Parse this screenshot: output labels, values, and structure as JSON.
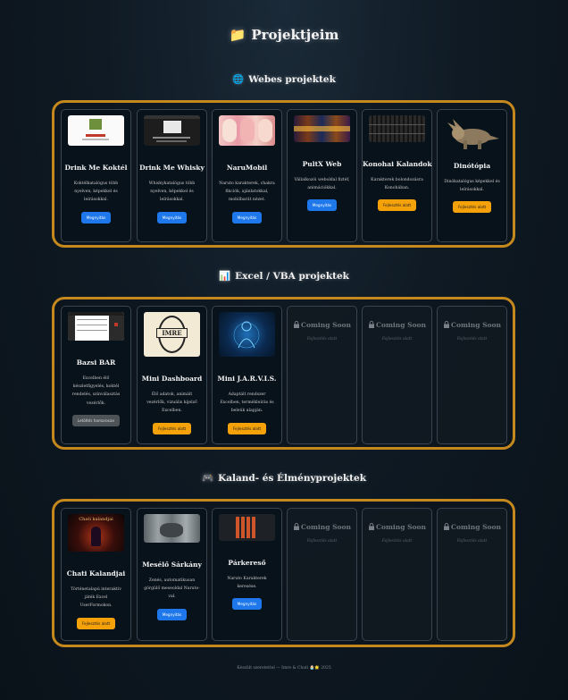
{
  "page_title": "Projektjeim",
  "sections": [
    {
      "title": "Webes projektek",
      "icon": "globe-icon",
      "cards": [
        {
          "name": "Drink Me Koktél",
          "desc": "Koktélkatalógus több nyelven, képekkel és leírásokkal.",
          "button": "Megnyitás",
          "button_color": "blue"
        },
        {
          "name": "Drink Me Whisky",
          "desc": "Whiskykatalógus több nyelven, képekkel és leírásokkal.",
          "button": "Megnyitás",
          "button_color": "blue"
        },
        {
          "name": "NaruMobil",
          "desc": "Naruto karakterek, chakra fikciók, ajánlatokkal, mobilbarát nézet.",
          "button": "Megnyitás",
          "button_color": "blue"
        },
        {
          "name": "PultX Web",
          "desc": "Vállalkozói weboldal fiztéf, animációkkal.",
          "button": "Megnyitás",
          "button_color": "blue"
        },
        {
          "name": "Konohai Kalandok",
          "desc": "Karakterek bolondozásra Konohában.",
          "button": "Fejlesztés alatt",
          "button_color": "orange"
        },
        {
          "name": "Dinótópia",
          "desc": "Dinókatalógus képekkel és leírásokkal.",
          "button": "Fejlesztés alatt",
          "button_color": "orange"
        }
      ]
    },
    {
      "title": "Excel / VBA projektek",
      "icon": "bar-chart-icon",
      "cards": [
        {
          "name": "Bazsi BAR",
          "desc": "Excelben élő készletfigyelés, koktél rendelés, színválasztás vezérlők.",
          "button": "Letöltés hamarosan",
          "button_color": "gray"
        },
        {
          "name": "Mini Dashboard",
          "desc": "Élő adatok, animált vezérlők, vizuális kijelző Excelben.",
          "button": "Fejlesztés alatt",
          "button_color": "orange"
        },
        {
          "name": "Mini J.A.R.V.I.S.",
          "desc": "Adaptált rendszer Excelben, termékleírás és beleük alapján.",
          "button": "Fejlesztés alatt",
          "button_color": "orange"
        }
      ],
      "coming_soon": [
        {
          "title": "Coming Soon",
          "sub": "Fejlesztés alatt"
        },
        {
          "title": "Coming Soon",
          "sub": "Fejlesztés alatt"
        },
        {
          "title": "Coming Soon",
          "sub": "Fejlesztés alatt"
        }
      ]
    },
    {
      "title": "Kaland- és Élményprojektek",
      "icon": "gamepad-icon",
      "cards": [
        {
          "name": "Chati Kalandjai",
          "desc": "Történetalapú interaktív játék Excel UserFormokon.",
          "button": "Fejlesztés alatt",
          "button_color": "orange"
        },
        {
          "name": "Mesélő Sárkány",
          "desc": "Zenés, automatikusan görgülő meseoldal Naruto-val.",
          "button": "Megnyitás",
          "button_color": "blue"
        },
        {
          "name": "Párkereső",
          "desc": "Naruto Karakterek keresése.",
          "button": "Megnyitás",
          "button_color": "blue"
        }
      ],
      "coming_soon": [
        {
          "title": "Coming Soon",
          "sub": "Fejlesztés alatt"
        },
        {
          "title": "Coming Soon",
          "sub": "Fejlesztés alatt"
        },
        {
          "title": "Coming Soon",
          "sub": "Fejlesztés alatt"
        }
      ],
      "card0_thumb_text": "Chati kalandjai"
    }
  ],
  "thumb_labels": {
    "mini_dashboard": "IMRE"
  },
  "footer": "Készült szeretettel — Imre & Chati 🧁🌟 2025",
  "colors": {
    "accent_orange": "#c4881c",
    "button_blue": "#1e78ec",
    "button_orange": "#f4a10a",
    "button_gray": "#4e5358"
  }
}
